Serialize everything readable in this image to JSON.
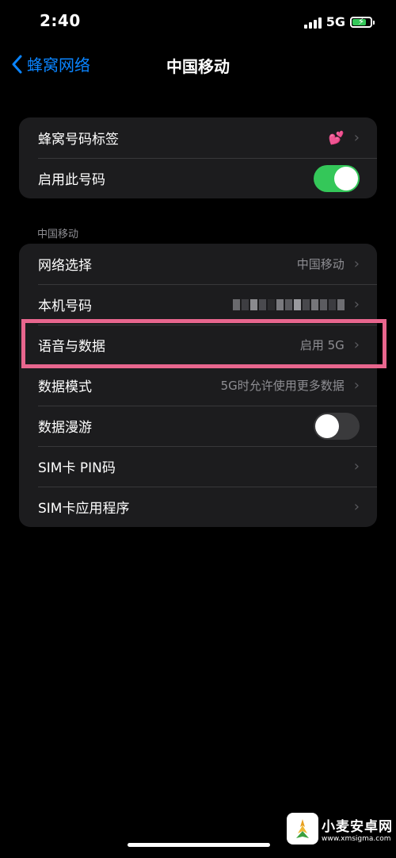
{
  "status": {
    "time": "2:40",
    "network": "5G",
    "battery_level": 0.75
  },
  "nav": {
    "back_label": "蜂窝网络",
    "title": "中国移动"
  },
  "group1": {
    "rows": [
      {
        "label": "蜂窝号码标签",
        "value_icon": "two-hearts-icon"
      },
      {
        "label": "启用此号码",
        "toggle": true
      }
    ]
  },
  "section_header": "中国移动",
  "group2": {
    "rows": [
      {
        "label": "网络选择",
        "value": "中国移动"
      },
      {
        "label": "本机号码",
        "value_masked": true
      },
      {
        "label": "语音与数据",
        "value": "启用 5G",
        "highlighted": true
      },
      {
        "label": "数据模式",
        "value": "5G时允许使用更多数据"
      },
      {
        "label": "数据漫游",
        "toggle": false
      },
      {
        "label": "SIM卡 PIN码"
      },
      {
        "label": "SIM卡应用程序"
      }
    ]
  },
  "highlight_color": "#e8668e",
  "watermark": {
    "title": "小麦安卓网",
    "url": "www.xmsigma.com"
  },
  "colors": {
    "accent": "#0a84ff",
    "toggle_on": "#34c759",
    "background": "#000000",
    "cell": "#1c1c1e"
  }
}
